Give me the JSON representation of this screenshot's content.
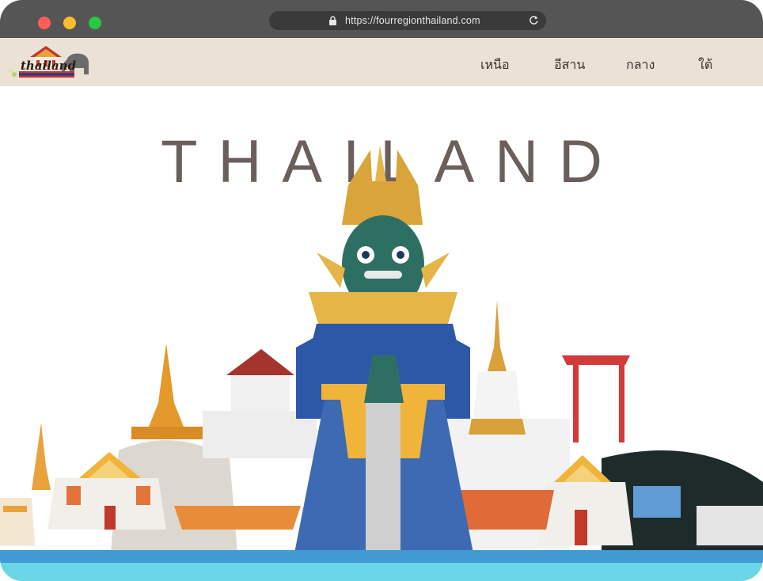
{
  "browser": {
    "url": "https://fourregionthailand.com"
  },
  "nav": {
    "logo_text": "thailand",
    "items": [
      {
        "label": "เหนือ"
      },
      {
        "label": "อีสาน"
      },
      {
        "label": "กลาง"
      },
      {
        "label": "ใต้"
      }
    ]
  },
  "hero": {
    "title": "THAILAND",
    "illustration": "thai-giant-temple-skyline-illustration"
  },
  "colors": {
    "titlebar": "#555555",
    "navbar": "#ece1d6",
    "title_text": "#6b5f5c",
    "water": "#6bd6e8"
  }
}
